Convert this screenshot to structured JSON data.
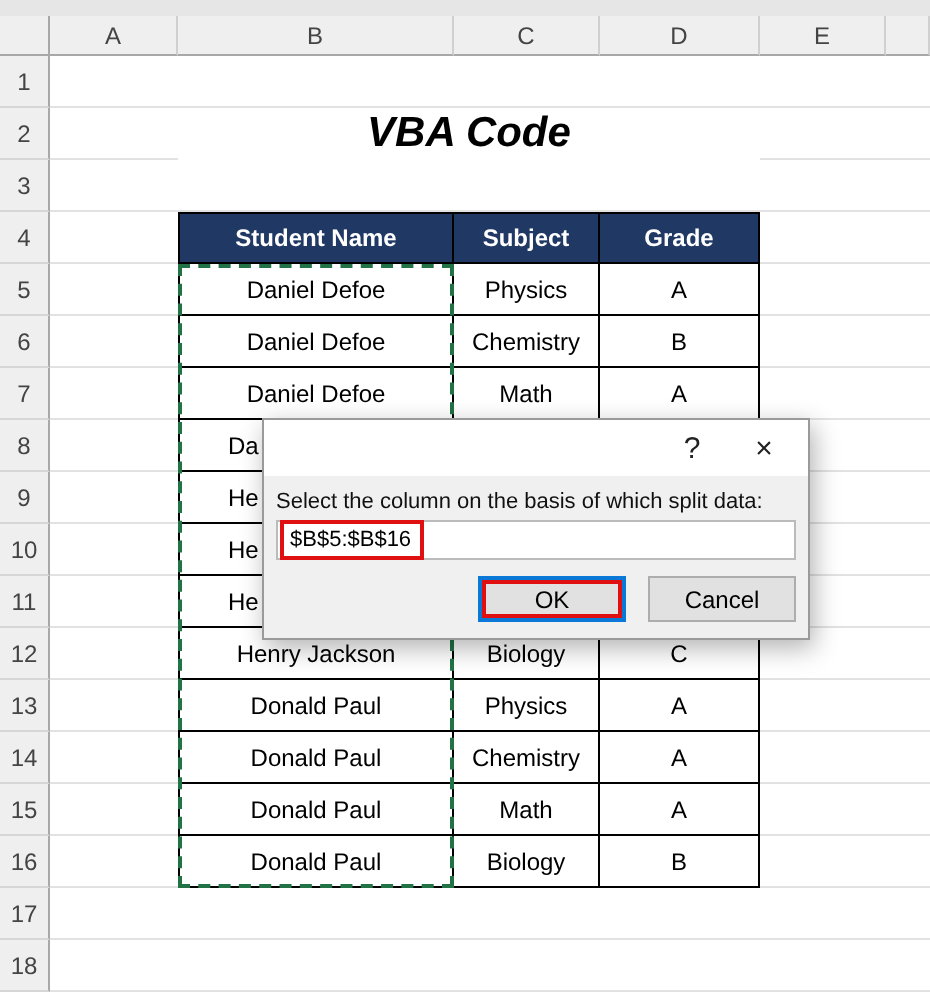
{
  "sheet": {
    "columns": [
      "A",
      "B",
      "C",
      "D",
      "E"
    ],
    "rows": [
      "1",
      "2",
      "3",
      "4",
      "5",
      "6",
      "7",
      "8",
      "9",
      "10",
      "11",
      "12",
      "13",
      "14",
      "15",
      "16",
      "17",
      "18"
    ],
    "title": "VBA Code",
    "table": {
      "headers": [
        "Student Name",
        "Subject",
        "Grade"
      ],
      "rows": [
        {
          "covered": false,
          "cells": [
            "Daniel Defoe",
            "Physics",
            "A"
          ]
        },
        {
          "covered": false,
          "cells": [
            "Daniel Defoe",
            "Chemistry",
            "B"
          ]
        },
        {
          "covered": false,
          "cells": [
            "Daniel Defoe",
            "Math",
            "A"
          ]
        },
        {
          "covered": true,
          "cells": [
            "Da"
          ]
        },
        {
          "covered": true,
          "cells": [
            "He"
          ]
        },
        {
          "covered": true,
          "cells": [
            "He"
          ]
        },
        {
          "covered": true,
          "cells": [
            "He"
          ]
        },
        {
          "covered": false,
          "cells": [
            "Henry Jackson",
            "Biology",
            "C"
          ]
        },
        {
          "covered": false,
          "cells": [
            "Donald Paul",
            "Physics",
            "A"
          ]
        },
        {
          "covered": false,
          "cells": [
            "Donald Paul",
            "Chemistry",
            "A"
          ]
        },
        {
          "covered": false,
          "cells": [
            "Donald Paul",
            "Math",
            "A"
          ]
        },
        {
          "covered": false,
          "cells": [
            "Donald Paul",
            "Biology",
            "B"
          ]
        }
      ]
    }
  },
  "dialog": {
    "help": "?",
    "close": "×",
    "prompt": "Select the column on the basis of which split data:",
    "input": {
      "value": "$B$5:$B$16",
      "highlighted": true
    },
    "buttons": [
      {
        "label": "OK",
        "focused": true,
        "highlighted": true
      },
      {
        "label": "Cancel",
        "focused": false,
        "highlighted": false
      }
    ]
  }
}
